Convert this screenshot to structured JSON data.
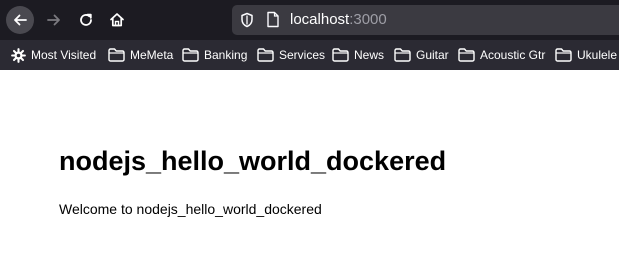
{
  "browser": {
    "url_host": "localhost",
    "url_port": ":3000",
    "icons": {
      "back": "back-arrow-icon",
      "forward": "forward-arrow-icon",
      "reload": "reload-icon",
      "home": "home-icon",
      "tracking": "shield-icon",
      "page": "page-icon"
    }
  },
  "bookmarks": [
    {
      "label": "Most Visited",
      "icon": "gear-icon"
    },
    {
      "label": "MeMeta",
      "icon": "folder-icon"
    },
    {
      "label": "Banking",
      "icon": "folder-icon"
    },
    {
      "label": "Services",
      "icon": "folder-icon"
    },
    {
      "label": "News",
      "icon": "folder-icon"
    },
    {
      "label": "Guitar",
      "icon": "folder-icon"
    },
    {
      "label": "Acoustic Gtr",
      "icon": "folder-icon"
    },
    {
      "label": "Ukulele",
      "icon": "folder-icon"
    }
  ],
  "page": {
    "heading": "nodejs_hello_world_dockered",
    "welcome": "Welcome to nodejs_hello_world_dockered"
  },
  "colors": {
    "toolbar_bg": "#1c1b22",
    "bookmarks_bg": "#2b2a33",
    "urlbar_bg": "#3b3a41",
    "page_bg": "#ffffff"
  }
}
